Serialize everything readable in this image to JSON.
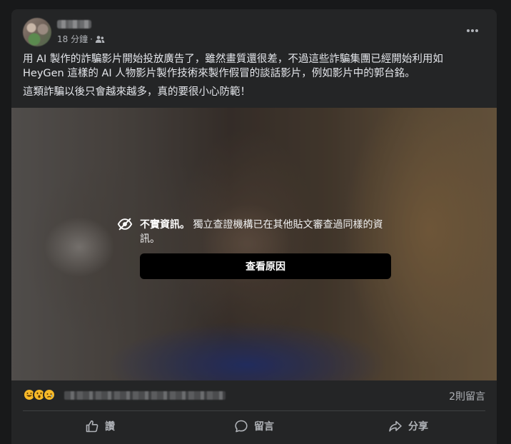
{
  "post": {
    "author_name": "",
    "timestamp": "18 分鐘",
    "separator": "·",
    "audience_icon": "friends-icon",
    "more_icon": "more-horizontal-icon",
    "text_line1": "用 AI 製作的詐騙影片開始投放廣告了，雖然畫質還很差，不過這些詐騙集團已經開始利用如 HeyGen 這樣的 AI 人物影片製作技術來製作假冒的談話影片，例如影片中的郭台銘。",
    "text_line2": "這類詐騙以後只會越來越多，真的要很小心防範！"
  },
  "media": {
    "warning_title": "不實資訊。",
    "warning_body": " 獨立查證機構已在其他貼文審查過同樣的資訊。",
    "see_why_label": "查看原因"
  },
  "reactions": {
    "emoji_icons": [
      "haha-icon",
      "wow-icon",
      "sad-icon"
    ],
    "comment_count": "2則留言"
  },
  "actions": {
    "like_label": "讚",
    "comment_label": "留言",
    "share_label": "分享"
  },
  "colors": {
    "background": "#18191a",
    "card": "#242526",
    "primary_text": "#e4e6eb",
    "secondary_text": "#b0b3b8",
    "button_bg": "#000000"
  }
}
